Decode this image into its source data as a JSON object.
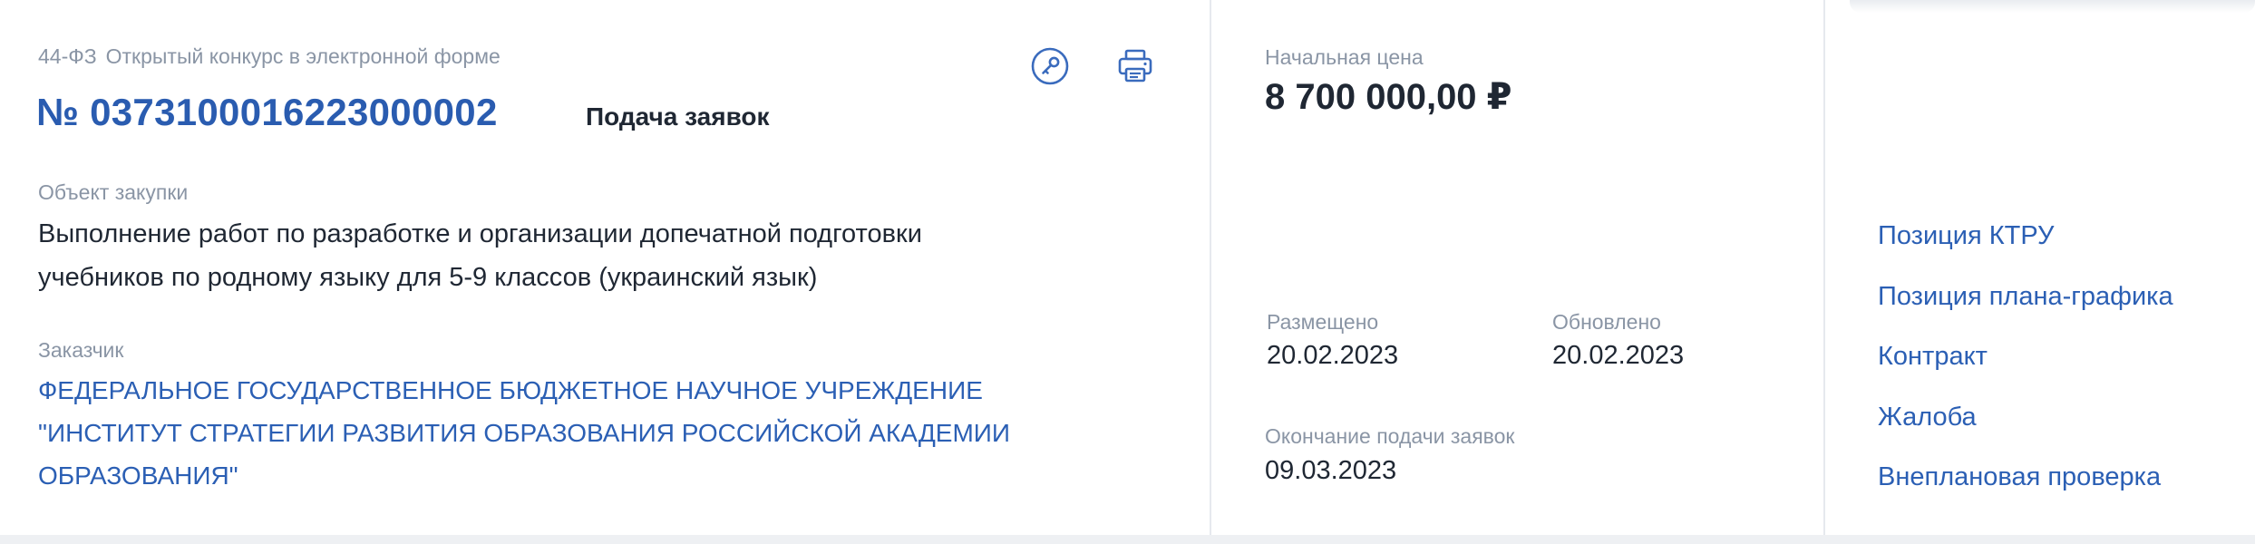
{
  "procurement": {
    "law": "44-ФЗ",
    "type": "Открытый конкурс в электронной форме",
    "number": "№ 0373100016223000002",
    "status": "Подача заявок"
  },
  "object": {
    "label": "Объект закупки",
    "lines": [
      "Выполнение работ по разработке и организации допечатной подготовки",
      "учебников по родному языку для 5-9 классов (украинский язык)"
    ]
  },
  "customer": {
    "label": "Заказчик",
    "lines": [
      "ФЕДЕРАЛЬНОЕ ГОСУДАРСТВЕННОЕ БЮДЖЕТНОЕ НАУЧНОЕ УЧРЕЖДЕНИЕ",
      "\"ИНСТИТУТ СТРАТЕГИИ РАЗВИТИЯ ОБРАЗОВАНИЯ РОССИЙСКОЙ АКАДЕМИИ",
      "ОБРАЗОВАНИЯ\""
    ]
  },
  "price": {
    "label": "Начальная цена",
    "value": "8 700 000,00 ₽"
  },
  "dates": {
    "placed_label": "Размещено",
    "placed_value": "20.02.2023",
    "updated_label": "Обновлено",
    "updated_value": "20.02.2023",
    "deadline_label": "Окончание подачи заявок",
    "deadline_value": "09.03.2023"
  },
  "links": [
    "Позиция КТРУ",
    "Позиция плана-графика",
    "Контракт",
    "Жалоба",
    "Внеплановая проверка"
  ],
  "icons": {
    "key": "key-icon",
    "print": "printer-icon"
  },
  "colors": {
    "link": "#2b5fb4",
    "number": "#2a5cb0",
    "label": "#8a95a5",
    "text": "#1f2733"
  }
}
